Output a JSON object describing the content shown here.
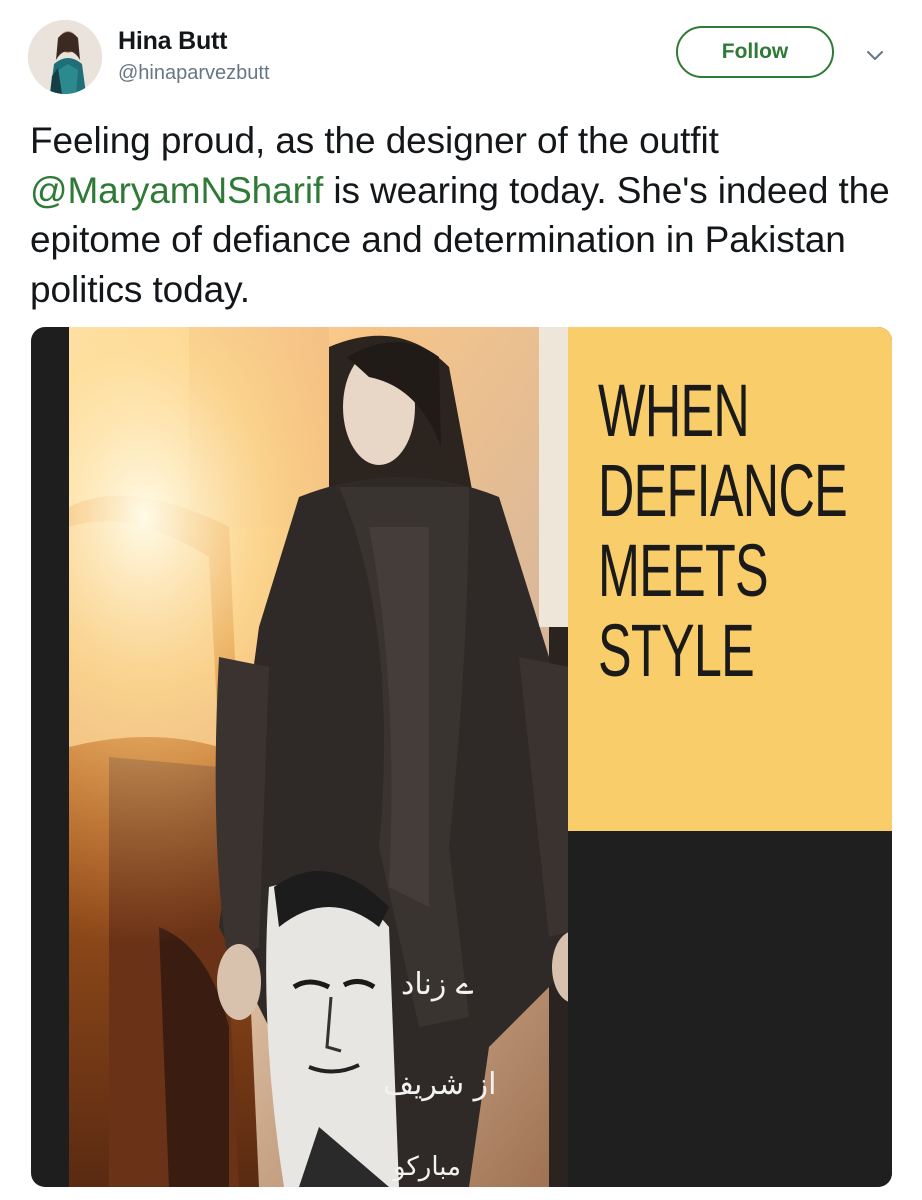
{
  "author": {
    "display_name": "Hina Butt",
    "handle": "@hinaparvezbutt",
    "avatar_icon": "profile-photo"
  },
  "actions": {
    "follow_label": "Follow",
    "more_icon": "chevron-down-icon"
  },
  "tweet": {
    "text_before": "Feeling proud, as the designer of the outfit ",
    "mention": "@MaryamNSharif",
    "text_after": " is wearing today. She's indeed the epitome of defiance and determination in Pakistan politics today."
  },
  "media": {
    "headline_lines": [
      "WHEN",
      "DEFIANCE",
      "MEEТS",
      "STYLE"
    ],
    "shirt_text_lines": [
      "ے زناد",
      "از شریف",
      "مبارکو"
    ]
  },
  "colors": {
    "accent": "#2f7a36",
    "panel_yellow": "#f8cd6a",
    "panel_dark": "#1f1f1f"
  }
}
